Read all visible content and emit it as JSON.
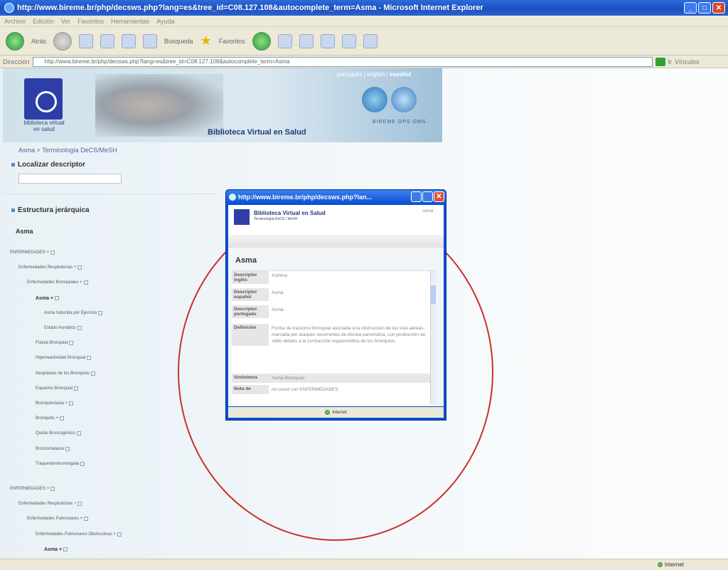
{
  "window": {
    "title": "http://www.bireme.br/php/decsws.php?lang=es&tree_id=C08.127.108&autocomplete_term=Asma - Microsoft Internet Explorer"
  },
  "menubar": [
    "Archivo",
    "Edición",
    "Ver",
    "Favoritos",
    "Herramientas",
    "Ayuda"
  ],
  "toolbar": {
    "back": "Atrás",
    "search": "Búsqueda",
    "favorites": "Favoritos"
  },
  "address": {
    "label": "Dirección",
    "url": "http://www.bireme.br/php/decsws.php?lang=es&tree_id=C08.127.108&autocomplete_term=Asma",
    "go": "Ir",
    "links": "Vínculos"
  },
  "header": {
    "langs": "português | english | ",
    "langs_active": "español",
    "brand": "Biblioteca Virtual en Salud",
    "bvs": "bvs",
    "bvs_sub": "biblioteca virtual en salud",
    "orgs": "BIREME  OPS  OMS"
  },
  "breadcrumb": "Asma > Terminología DeCS/MeSH",
  "locate": {
    "title": "Localizar descriptor"
  },
  "hierarchy": {
    "title": "Estructura jerárquica",
    "root": "Asma"
  },
  "tree": [
    {
      "label": "ENFERMEDADES +",
      "level": 0,
      "bold": false
    },
    {
      "label": "Enfermedades Respiratorias +",
      "level": 1,
      "bold": false
    },
    {
      "label": "Enfermedades Bronquiales +",
      "level": 2,
      "bold": false
    },
    {
      "label": "Asma +",
      "level": 3,
      "bold": true
    },
    {
      "label": "Asma Inducida por Ejercicio",
      "level": 4,
      "bold": false
    },
    {
      "label": "Estado Asmático",
      "level": 4,
      "bold": false
    },
    {
      "label": "Fístula Bronquial",
      "level": 3,
      "bold": false
    },
    {
      "label": "Hiperreactividad Bronquial",
      "level": 3,
      "bold": false
    },
    {
      "label": "Neoplasias de los Bronquios",
      "level": 3,
      "bold": false
    },
    {
      "label": "Espasmo Bronquial",
      "level": 3,
      "bold": false
    },
    {
      "label": "Bronquiectasia +",
      "level": 3,
      "bold": false
    },
    {
      "label": "Bronquitis +",
      "level": 3,
      "bold": false
    },
    {
      "label": "Quiste Broncogénico",
      "level": 3,
      "bold": false
    },
    {
      "label": "Broncomalacia",
      "level": 3,
      "bold": false
    },
    {
      "label": "Traqueobroncomegalia",
      "level": 3,
      "bold": false
    },
    {
      "label": "ENFERMEDADES +",
      "level": 0,
      "bold": false
    },
    {
      "label": "Enfermedades Respiratorias +",
      "level": 1,
      "bold": false
    },
    {
      "label": "Enfermedades Pulmonares +",
      "level": 2,
      "bold": false
    },
    {
      "label": "Enfermedades Pulmonares Obstructivas +",
      "level": 3,
      "bold": false
    },
    {
      "label": "Asma +",
      "level": 4,
      "bold": true
    }
  ],
  "popup": {
    "title": "http://www.bireme.br/php/decsws.php?lan...",
    "brand": "Biblioteca Virtual en Salud",
    "sub": "Terminología DeCS / MeSH",
    "close": "cerrar",
    "term": "Asma",
    "rows": [
      {
        "label": "Descriptor inglés",
        "value": "Asthma"
      },
      {
        "label": "Descriptor español",
        "value": "Asma"
      },
      {
        "label": "Descriptor portugués",
        "value": "Asma"
      },
      {
        "label": "Definición",
        "value": "Forma de trastorno bronquial asociada a la obstrucción de las vías aéreas, marcada por ataques recurrentes de disnea paroxística, con producción de sibilo debido a la contracción espasmódica de los bronquios."
      },
      {
        "label": "Sinónimos",
        "value": "Asma Bronquial"
      },
      {
        "label": "Nota de",
        "value": "no coord con ENFERMEDADES"
      }
    ],
    "status": "Internet"
  },
  "statusbar": {
    "zone": "Internet"
  }
}
